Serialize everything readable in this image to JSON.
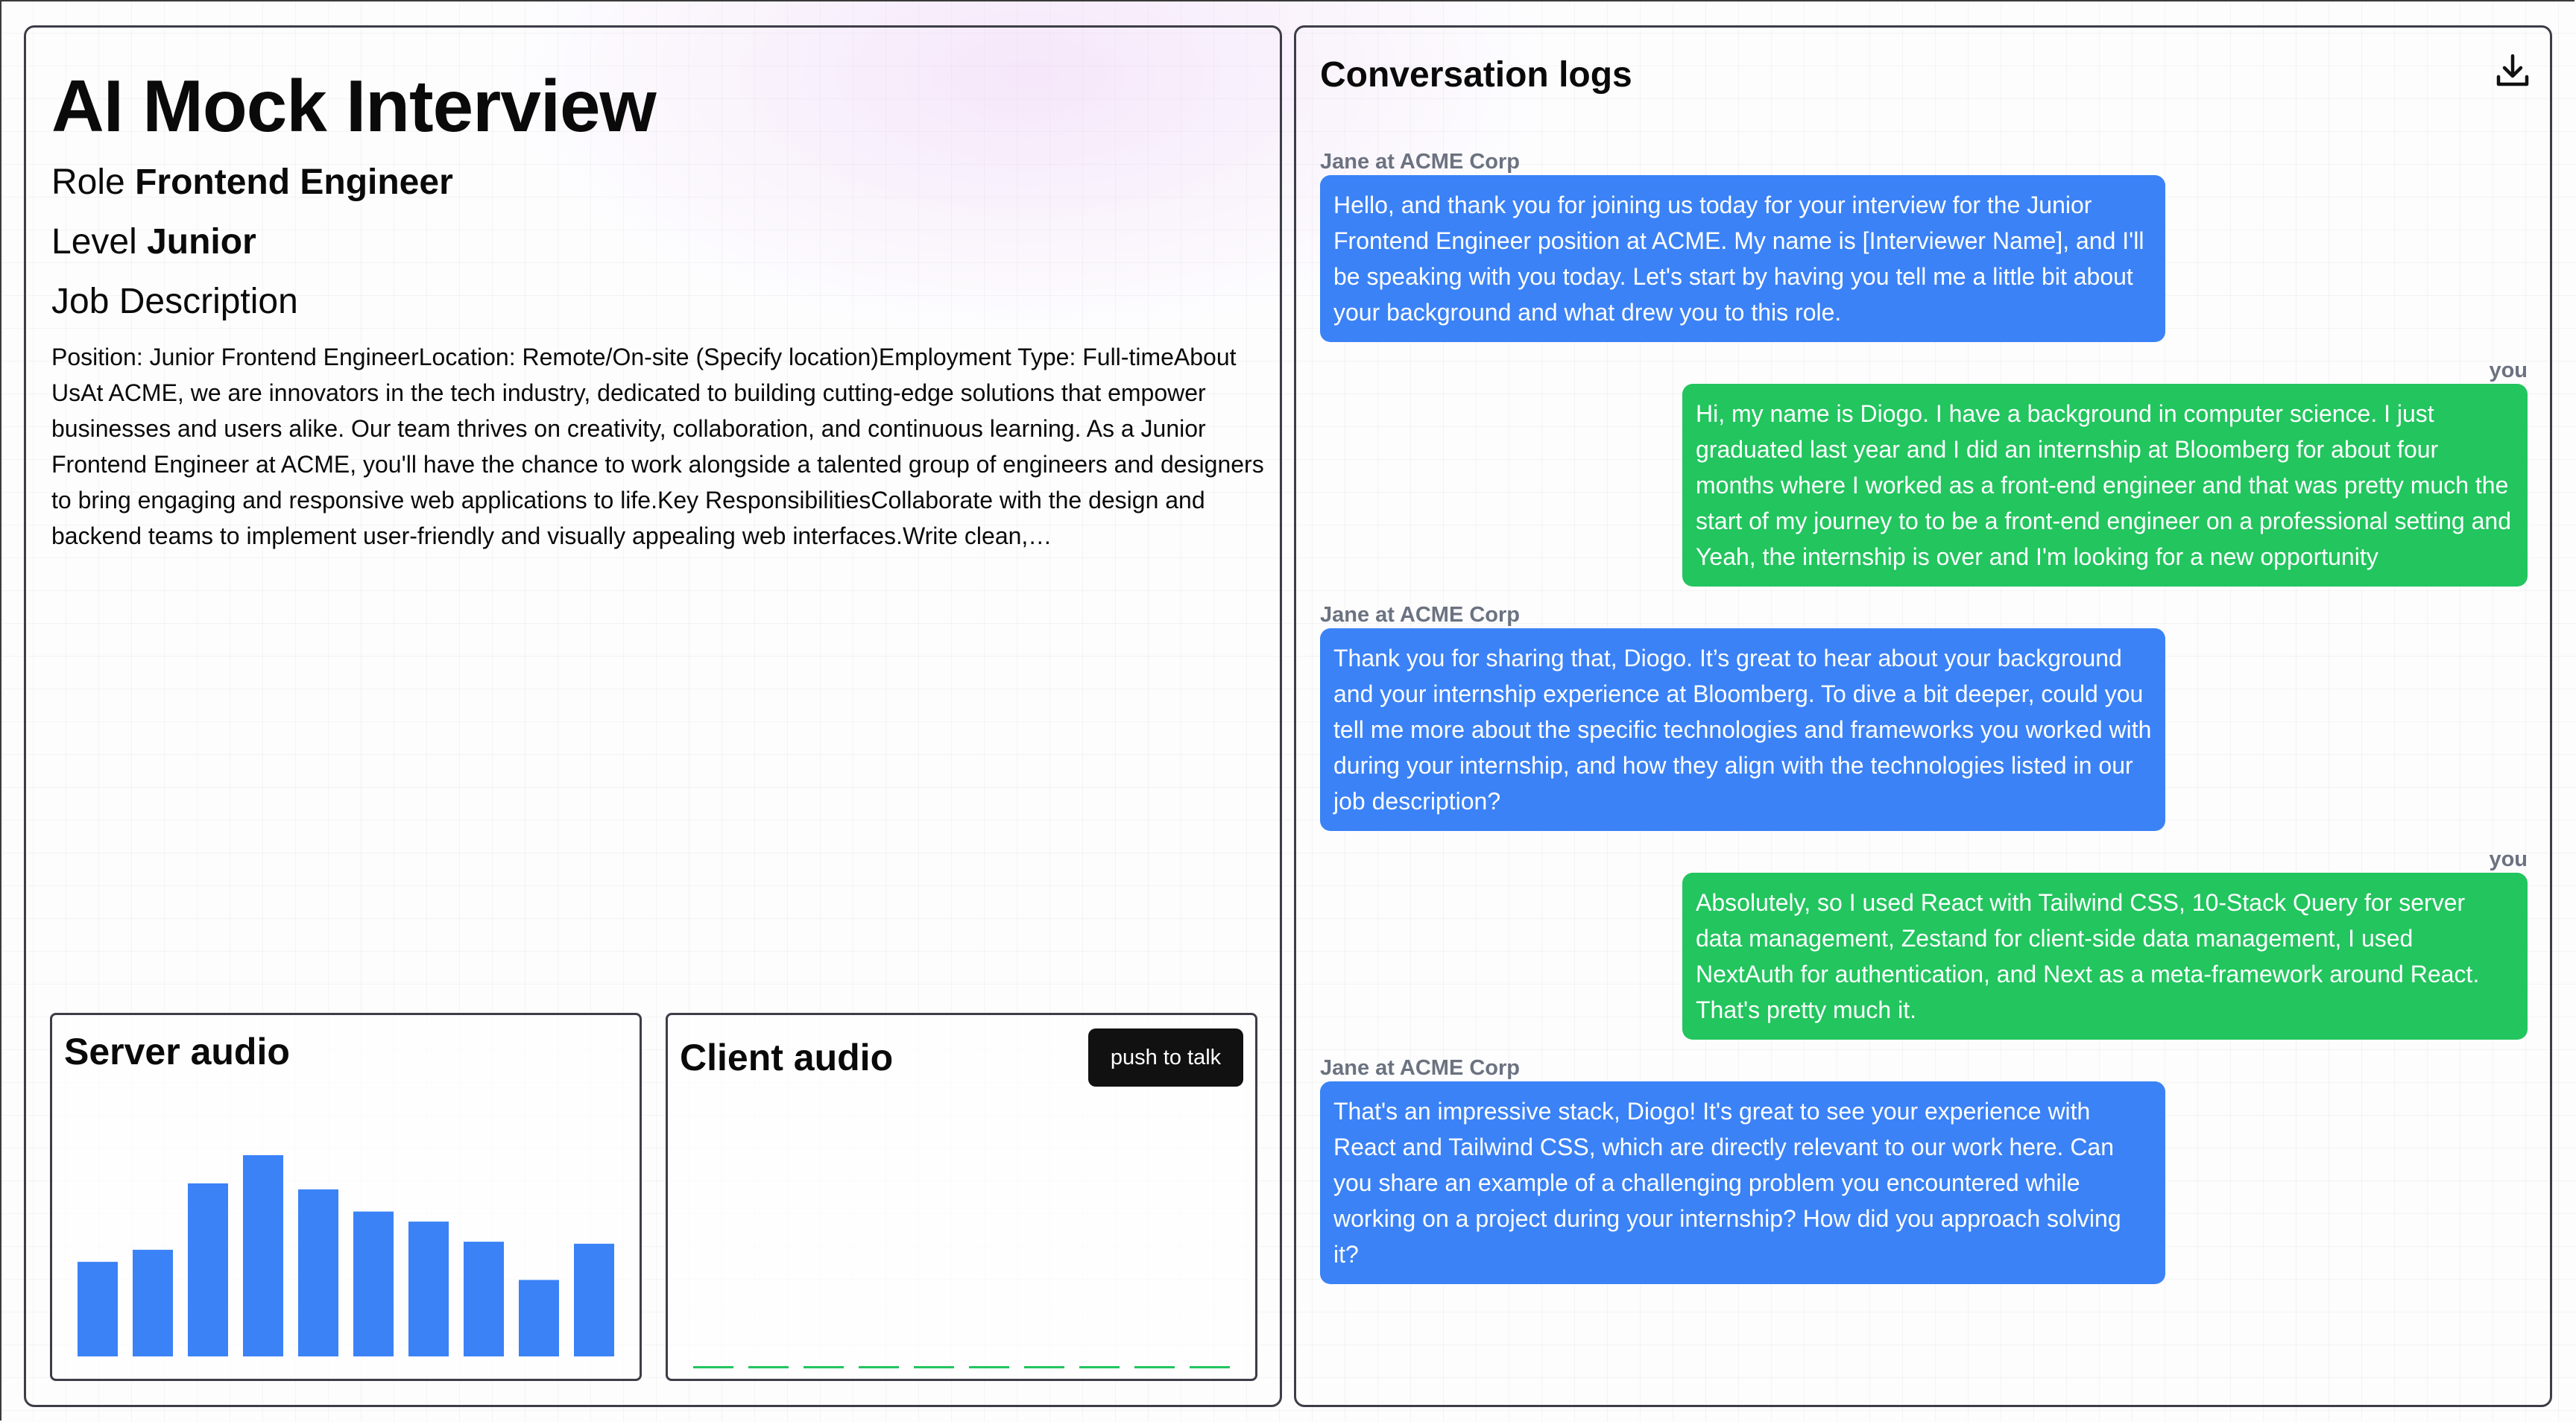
{
  "app": {
    "title": "AI Mock Interview",
    "role_label": "Role",
    "role_value": "Frontend Engineer",
    "level_label": "Level",
    "level_value": "Junior",
    "job_description_heading": "Job Description",
    "job_description_text": "Position: Junior Frontend EngineerLocation: Remote/On-site (Specify location)Employment Type: Full-timeAbout UsAt ACME, we are innovators in the tech industry, dedicated to building cutting-edge solutions that empower businesses and users alike. Our team thrives on creativity, collaboration, and continuous learning. As a Junior Frontend Engineer at ACME, you'll have the chance to work alongside a talented group of engineers and designers to bring engaging and responsive web applications to life.Key ResponsibilitiesCollaborate with the design and backend teams to implement user-friendly and visually appealing web interfaces.Write clean,…"
  },
  "server_audio": {
    "title": "Server audio",
    "levels": [
      0.47,
      0.53,
      0.86,
      1.0,
      0.83,
      0.72,
      0.67,
      0.57,
      0.38,
      0.56
    ],
    "bar_color": "#3b82f6"
  },
  "client_audio": {
    "title": "Client audio",
    "push_to_talk_label": "push to talk",
    "levels": [
      0,
      0,
      0,
      0,
      0,
      0,
      0,
      0,
      0,
      0
    ],
    "idle_color": "#22c55e"
  },
  "conversation": {
    "title": "Conversation logs",
    "download_icon": "download-icon",
    "messages": [
      {
        "sender": "Jane at ACME Corp",
        "role": "ai",
        "text": "Hello, and thank you for joining us today for your interview for the Junior Frontend Engineer position at ACME. My name is [Interviewer Name], and I'll be speaking with you today. Let's start by having you tell me a little bit about your background and what drew you to this role."
      },
      {
        "sender": "you",
        "role": "user",
        "text": "Hi, my name is Diogo. I have a background in computer science. I just graduated last year and I did an internship at Bloomberg for about four months where I worked as a front-end engineer and that was pretty much the start of my journey to to be a front-end engineer on a professional setting and Yeah, the internship is over and I'm looking for a new opportunity"
      },
      {
        "sender": "Jane at ACME Corp",
        "role": "ai",
        "text": "Thank you for sharing that, Diogo. It’s great to hear about your background and your internship experience at Bloomberg. To dive a bit deeper, could you tell me more about the specific technologies and frameworks you worked with during your internship, and how they align with the technologies listed in our job description?"
      },
      {
        "sender": "you",
        "role": "user",
        "text": "Absolutely, so I used React with Tailwind CSS, 10-Stack Query for server data management, Zestand for client-side data management, I used NextAuth for authentication, and Next as a meta-framework around React. That's pretty much it."
      },
      {
        "sender": "Jane at ACME Corp",
        "role": "ai",
        "text": "That's an impressive stack, Diogo! It's great to see your experience with React and Tailwind CSS, which are directly relevant to our work here. Can you share an example of a challenging problem you encountered while working on a project during your internship? How did you approach solving it?"
      }
    ]
  }
}
